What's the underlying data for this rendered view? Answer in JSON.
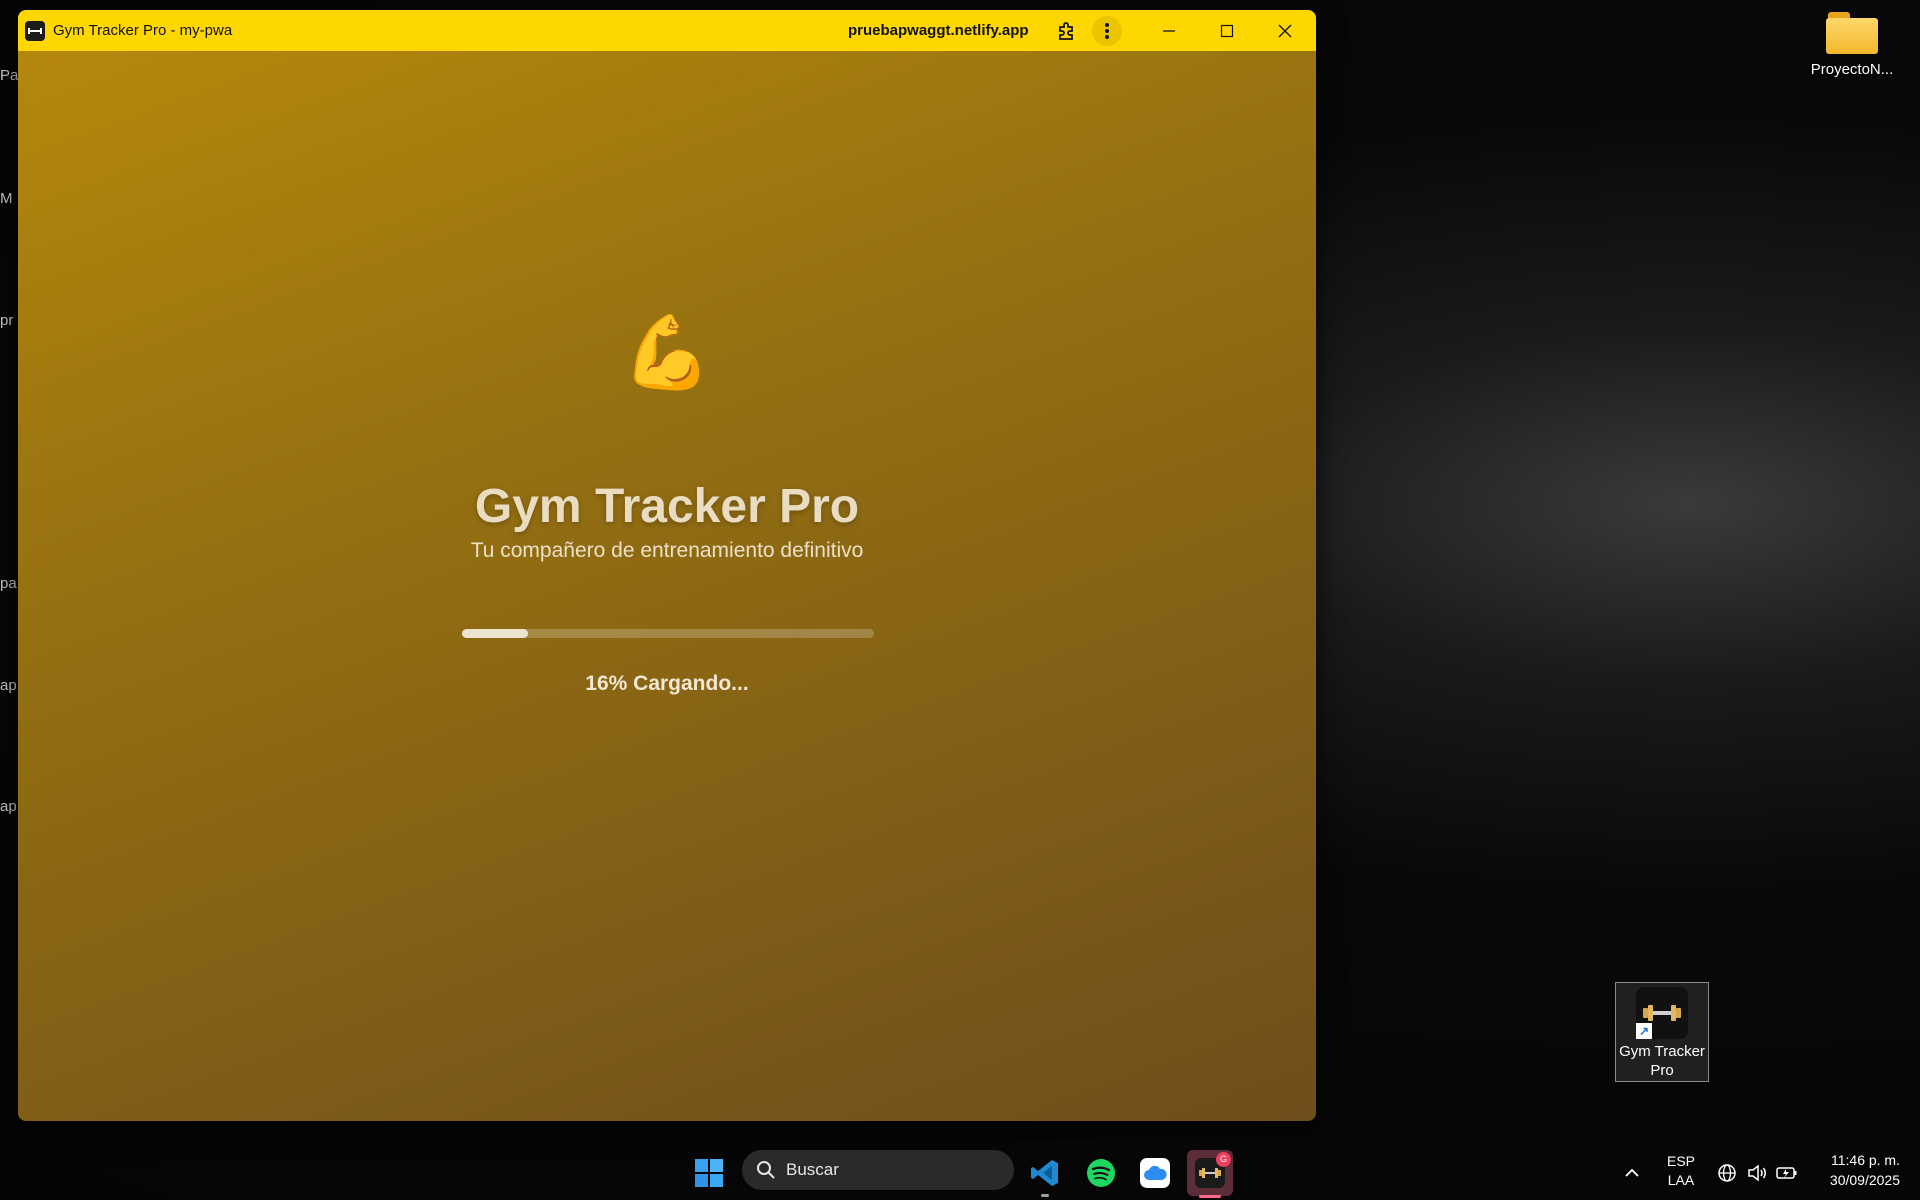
{
  "window": {
    "title": "Gym Tracker Pro - my-pwa",
    "url": "pruebapwaggt.netlify.app"
  },
  "splash": {
    "emoji": "💪",
    "title": "Gym Tracker Pro",
    "subtitle": "Tu compañero de entrenamiento definitivo",
    "progress_percent": 16,
    "progress_text": "16% Cargando..."
  },
  "desktop": {
    "left_edge_labels": [
      "Pa",
      "M",
      "pr",
      "pa",
      "ap",
      "ap"
    ],
    "folder": {
      "label": "ProyectoN...",
      "icon": "folder-icon"
    },
    "shortcut": {
      "label": "Gym Tracker Pro",
      "icon": "dumbbell-icon"
    }
  },
  "taskbar": {
    "search_placeholder": "Buscar",
    "apps": [
      "windows-start-icon",
      "vscode-icon",
      "spotify-icon",
      "icloud-icon",
      "gym-tracker-icon"
    ],
    "badge_letter": "G",
    "language": "ESP",
    "layout": "LAA",
    "time": "11:46 p. m.",
    "date": "30/09/2025"
  },
  "colors": {
    "titlebar": "#ffd700",
    "splash_gradient_start": "#b5880c",
    "splash_gradient_end": "#6e4d1c"
  }
}
